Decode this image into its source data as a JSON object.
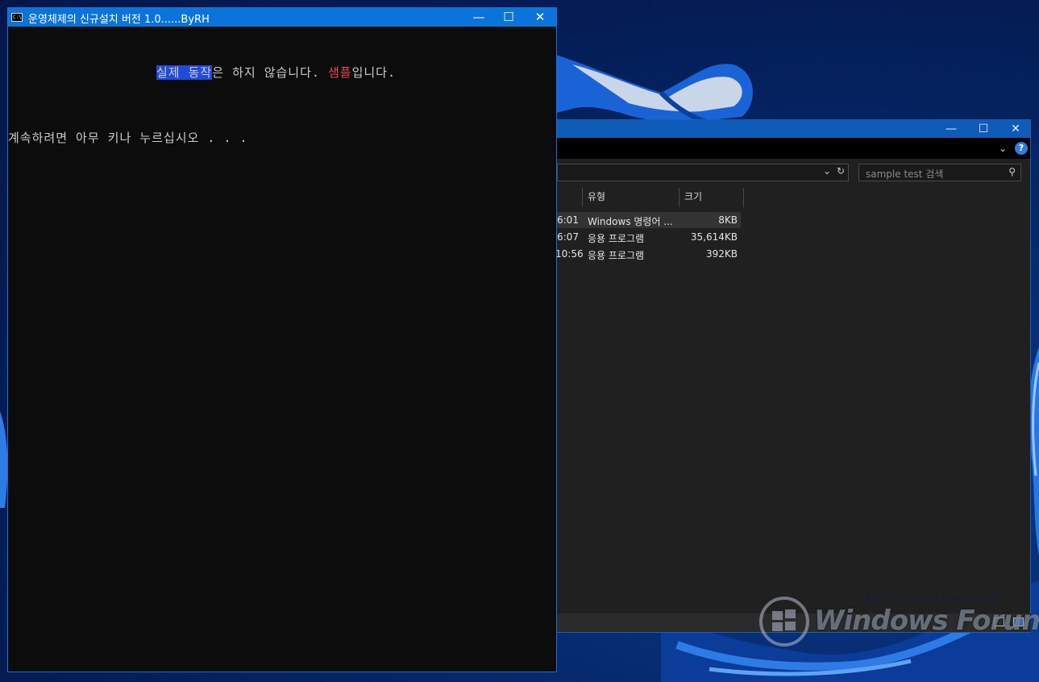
{
  "console": {
    "title": "운영체제의 신규설치 버전 1.0......ByRH",
    "icon": "terminal-icon",
    "controls": {
      "minimize": "—",
      "maximize": "☐",
      "close": "✕"
    },
    "line1": {
      "selected": "실제 동작",
      "middle": "은 하지 않습니다. ",
      "red": "샘플",
      "end": "입니다."
    },
    "line2": "계속하려면 아무 키나 누르십시오 . . ."
  },
  "explorer": {
    "controls": {
      "minimize": "—",
      "maximize": "☐",
      "close": "✕"
    },
    "help_icon": "?",
    "search_placeholder": "sample test 검색",
    "columns": {
      "type": "유형",
      "size": "크기"
    },
    "rows": [
      {
        "time": "6:01",
        "type": "Windows 명령어 ...",
        "size": "8KB"
      },
      {
        "time": "6:07",
        "type": "응용 프로그램",
        "size": "35,614KB"
      },
      {
        "time": "10:56",
        "type": "응용 프로그램",
        "size": "392KB"
      }
    ]
  },
  "watermark": {
    "tagline": "Best Windows Community!",
    "brand": "Windows Forum"
  },
  "colors": {
    "console_bg": "#0c0c0c",
    "console_title": "#0a74da",
    "selection": "#1f4bd8",
    "red_text": "#e74856",
    "explorer_bg": "#202020"
  }
}
